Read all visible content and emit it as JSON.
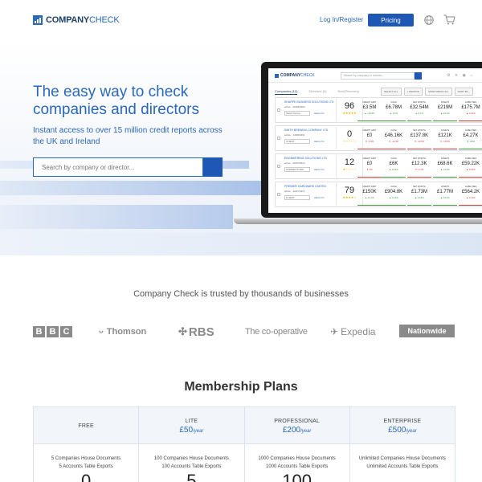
{
  "header": {
    "logo_bold": "COMPANY",
    "logo_light": "CHECK",
    "login_label": "Log In/Register",
    "pricing_label": "Pricing",
    "icons": [
      "globe-icon",
      "cart-icon"
    ]
  },
  "hero": {
    "title": "The easy way to check companies and directors",
    "subtitle": "Instant access to over 15 million credit reports across the UK and Ireland",
    "search_placeholder": "Search by company or director...",
    "accent": "#2a68b9",
    "button_color": "#1e58b4"
  },
  "laptop": {
    "logo_bold": "COMPANY",
    "logo_light": "CHECK",
    "search_placeholder": "Search by company or director...",
    "tabs": [
      "Companies (12)",
      "Directors (4)",
      "Debt Recovery"
    ],
    "actions": [
      "SELECT ALL",
      "+ REMOVE",
      "MONITORING ALL",
      "SORT BY..."
    ],
    "metric_labels": [
      "CREDIT LIMIT",
      "CASH",
      "NET WORTH",
      "ASSETS",
      "LIABILITIES"
    ],
    "cards": [
      {
        "name": "SHARPE BUSINESS SOLUTIONS LTD",
        "meta": "active · 29/08/1993",
        "select": "Select Group...",
        "alert": "Alerts On",
        "score": "96",
        "stars": "★★★★★",
        "metrics": [
          {
            "value": "£3.5M",
            "change": "▲ +40.9%",
            "dir": "up"
          },
          {
            "value": "£6.78M",
            "change": "▲ 2.4%",
            "dir": "up"
          },
          {
            "value": "£32.54M",
            "change": "▲ 5.1%",
            "dir": "up"
          },
          {
            "value": "£219M",
            "change": "▲ 44.4%",
            "dir": "up"
          },
          {
            "value": "£175.7M",
            "change": "▲ 14.9%",
            "dir": "down"
          }
        ]
      },
      {
        "name": "SMITH BREWING COMPANY LTD",
        "meta": "active · 14/06/1991",
        "select": "CLIENT",
        "alert": "Alerts On",
        "score": "0",
        "stars": "☆☆☆☆☆",
        "metrics": [
          {
            "value": "£0",
            "change": "▼ -2.5%",
            "dir": "down"
          },
          {
            "value": "£46.16K",
            "change": "▼ -12.4%",
            "dir": "down"
          },
          {
            "value": "£137.8K",
            "change": "▼ -13.5%",
            "dir": "down"
          },
          {
            "value": "£121K",
            "change": "▼ -10.5%",
            "dir": "down"
          },
          {
            "value": "£4.27K",
            "change": "▼ -95%",
            "dir": "up"
          }
        ]
      },
      {
        "name": "ENGINEERING SOLUTIONS LTD",
        "meta": "active · 03/07/2014",
        "select": "COMPETITORS",
        "alert": "Alerts On",
        "score": "12",
        "stars": "★☆☆☆☆",
        "metrics": [
          {
            "value": "£0",
            "change": "▼ 0%",
            "dir": "down"
          },
          {
            "value": "£6K",
            "change": "▲ 33.9%",
            "dir": "up"
          },
          {
            "value": "£12.3K",
            "change": "▼ -3.1%",
            "dir": "down"
          },
          {
            "value": "£68.6K",
            "change": "▲ 13.5%",
            "dir": "up"
          },
          {
            "value": "£59.22K",
            "change": "▲ 10.5%",
            "dir": "down"
          }
        ]
      },
      {
        "name": "PREMIER HARDWARE LIMITED",
        "meta": "active · 12/07/1971",
        "select": "CLIENT",
        "alert": "Alerts On",
        "score": "79",
        "stars": "★★★★☆",
        "metrics": [
          {
            "value": "£150K",
            "change": "▲ 12.1%",
            "dir": "up"
          },
          {
            "value": "£904.8K",
            "change": "▲ 14.3%",
            "dir": "up"
          },
          {
            "value": "£1.73M",
            "change": "▲ 14.8%",
            "dir": "up"
          },
          {
            "value": "£1.77M",
            "change": "▲ 15.2%",
            "dir": "up"
          },
          {
            "value": "£564.2K",
            "change": "▲ 11.9%",
            "dir": "down"
          }
        ]
      }
    ]
  },
  "trusted": {
    "title": "Company Check is trusted by thousands of businesses",
    "brands": [
      "BBC",
      "Thomson",
      "RBS",
      "The co-operative",
      "Expedia",
      "Nationwide"
    ]
  },
  "plans": {
    "title": "Membership Plans",
    "items": [
      {
        "name": "FREE",
        "price": "",
        "period": "",
        "docs1": "5 Companies House Documents",
        "docs2": "5 Accounts Table Exports",
        "big": "0"
      },
      {
        "name": "LITE",
        "price": "£50",
        "period": "/year",
        "docs1": "100 Companies House Documents",
        "docs2": "100 Accounts Table Exports",
        "big": "5"
      },
      {
        "name": "PROFESSIONAL",
        "price": "£200",
        "period": "/year",
        "docs1": "1000 Companies House Documents",
        "docs2": "1000 Accounts Table Exports",
        "big": "100"
      },
      {
        "name": "ENTERPRISE",
        "price": "£500",
        "period": "/year",
        "docs1": "Unlimited Companies House Documents",
        "docs2": "Unlimited Accounts Table Exports",
        "big": ""
      }
    ]
  }
}
